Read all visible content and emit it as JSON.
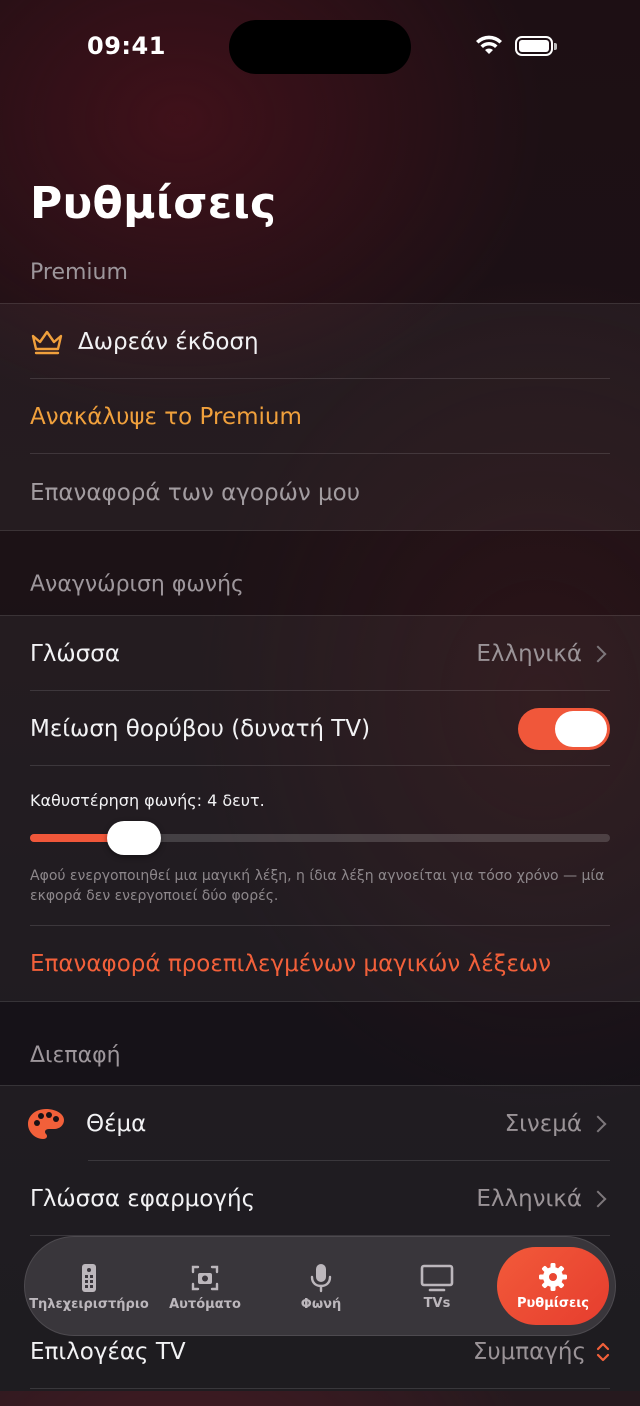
{
  "status_bar": {
    "time": "09:41"
  },
  "page": {
    "title": "Ρυθμίσεις"
  },
  "premium": {
    "header": "Premium",
    "free_version": "Δωρεάν έκδοση",
    "discover": "Ανακάλυψε το Premium",
    "restore": "Επαναφορά των αγορών μου"
  },
  "voice": {
    "header": "Αναγνώριση φωνής",
    "language_label": "Γλώσσα",
    "language_value": "Ελληνικά",
    "noise_label": "Μείωση θορύβου (δυνατή TV)",
    "noise_on": true,
    "delay_label": "Καθυστέρηση φωνής: 4 δευτ.",
    "delay_fraction": 0.18,
    "delay_hint": "Αφού ενεργοποιηθεί μια μαγική λέξη, η ίδια λέξη αγνοείται για τόσο χρόνο — μία εκφορά δεν ενεργοποιεί δύο φορές.",
    "reset_words": "Επαναφορά προεπιλεγμένων μαγικών λέξεων"
  },
  "interface": {
    "header": "Διεπαφή",
    "theme_label": "Θέμα",
    "theme_value": "Σινεμά",
    "app_language_label": "Γλώσσα εφαρμογής",
    "app_language_value": "Ελληνικά",
    "tv_selector_label": "Επιλογέας TV",
    "tv_selector_value": "Συμπαγής"
  },
  "tabs": [
    {
      "label": "Τηλεχειριστήριο",
      "icon": "remote-icon"
    },
    {
      "label": "Αυτόματο",
      "icon": "camera-scan-icon"
    },
    {
      "label": "Φωνή",
      "icon": "microphone-icon"
    },
    {
      "label": "TVs",
      "icon": "tv-icon"
    },
    {
      "label": "Ρυθμίσεις",
      "icon": "gear-icon",
      "active": true
    }
  ],
  "colors": {
    "accent": "#f0573a",
    "premium": "#f0a03c",
    "background": "#1a1216"
  }
}
